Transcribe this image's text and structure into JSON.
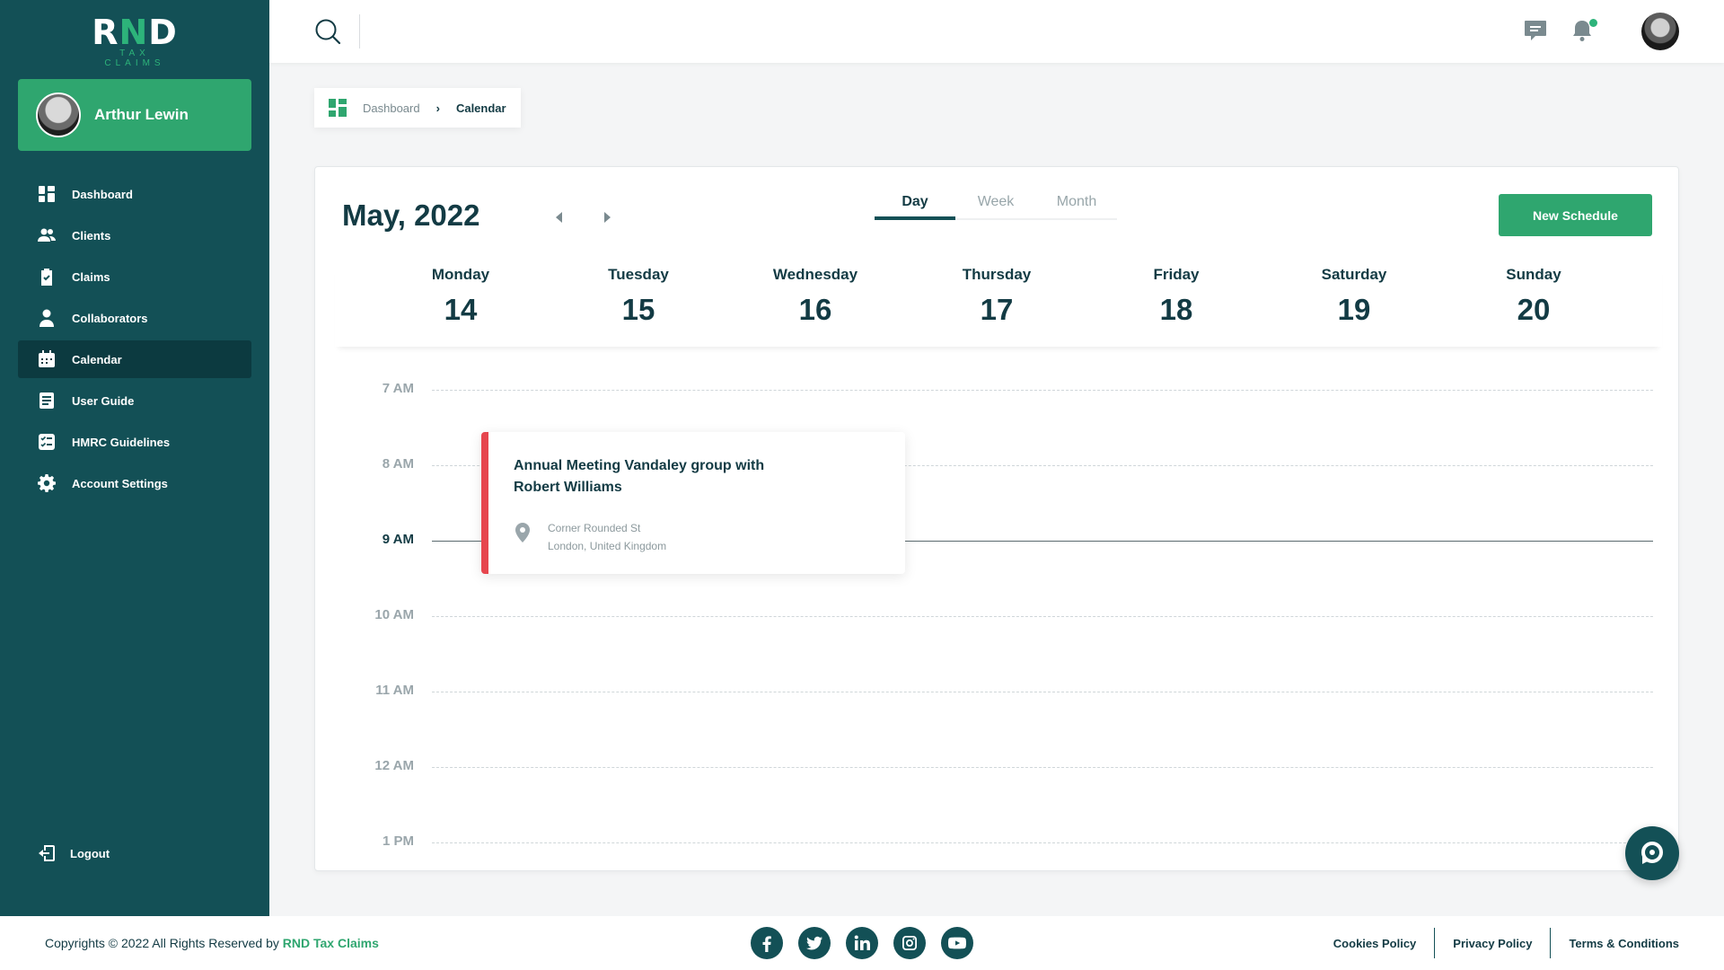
{
  "brand": {
    "logo_mark_a": "R",
    "logo_mark_x": "N",
    "logo_mark_b": "D",
    "logo_sub": "TAX CLAIMS"
  },
  "user": {
    "name": "Arthur Lewin"
  },
  "nav": {
    "items": [
      {
        "label": "Dashboard",
        "icon": "grid-icon"
      },
      {
        "label": "Clients",
        "icon": "users-icon"
      },
      {
        "label": "Claims",
        "icon": "clipboard-icon"
      },
      {
        "label": "Collaborators",
        "icon": "person-icon"
      },
      {
        "label": "Calendar",
        "icon": "calendar-icon",
        "active": true
      },
      {
        "label": "User Guide",
        "icon": "document-icon"
      },
      {
        "label": "HMRC Guidelines",
        "icon": "checklist-icon"
      },
      {
        "label": "Account Settings",
        "icon": "gear-icon"
      }
    ],
    "logout": "Logout"
  },
  "breadcrumb": {
    "root": "Dashboard",
    "current": "Calendar"
  },
  "calendar": {
    "month_title": "May, 2022",
    "views": [
      "Day",
      "Week",
      "Month"
    ],
    "active_view": "Day",
    "new_button": "New Schedule",
    "days": [
      {
        "name": "Monday",
        "num": "14"
      },
      {
        "name": "Tuesday",
        "num": "15"
      },
      {
        "name": "Wednesday",
        "num": "16"
      },
      {
        "name": "Thursday",
        "num": "17"
      },
      {
        "name": "Friday",
        "num": "18"
      },
      {
        "name": "Saturday",
        "num": "19"
      },
      {
        "name": "Sunday",
        "num": "20"
      }
    ],
    "times": [
      "7 AM",
      "8 AM",
      "9 AM",
      "10 AM",
      "11 AM",
      "12 AM",
      "1 PM"
    ],
    "current_time": "9 AM",
    "event": {
      "title": "Annual Meeting Vandaley group with Robert Williams",
      "address_line1": "Corner Rounded St",
      "address_line2": "London, United Kingdom",
      "color": "#e6464e"
    }
  },
  "footer": {
    "copyright_prefix": "Copyrights © 2022 All Rights Reserved by",
    "copyright_brand": "RND Tax Claims",
    "social": [
      "facebook-icon",
      "twitter-icon",
      "linkedin-icon",
      "instagram-icon",
      "youtube-icon"
    ],
    "policies": [
      "Cookies Policy",
      "Privacy Policy",
      "Terms & Conditions"
    ]
  },
  "colors": {
    "sidebar": "#135056",
    "accent": "#2fa66f",
    "event": "#e6464e"
  }
}
